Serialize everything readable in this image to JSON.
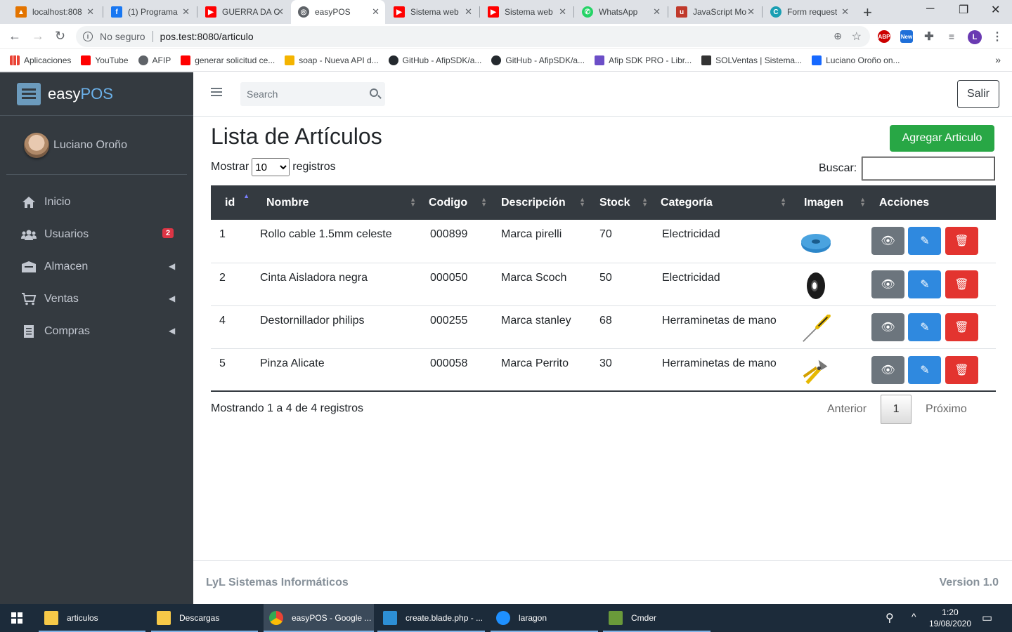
{
  "browser": {
    "tabs": [
      {
        "label": "localhost:808",
        "color": "#e37400"
      },
      {
        "label": "(1) Programa",
        "color": "#1877f2"
      },
      {
        "label": "GUERRA DA C",
        "color": "#ff0000"
      },
      {
        "label": "easyPOS",
        "color": "#5f6368"
      },
      {
        "label": "Sistema web",
        "color": "#ff0000"
      },
      {
        "label": "Sistema web",
        "color": "#ff0000"
      },
      {
        "label": "WhatsApp",
        "color": "#25d366"
      },
      {
        "label": "JavaScript Mo",
        "color": "#c0392b"
      },
      {
        "label": "Form request",
        "color": "#1a9fb3"
      }
    ],
    "address": {
      "security": "No seguro",
      "url": "pos.test:8080/articulo"
    },
    "bookmarks": [
      {
        "label": "Aplicaciones",
        "color": "#4285f4"
      },
      {
        "label": "YouTube",
        "color": "#ff0000"
      },
      {
        "label": "AFIP",
        "color": "#5f6368"
      },
      {
        "label": "generar solicitud ce...",
        "color": "#ff0000"
      },
      {
        "label": "soap - Nueva API d...",
        "color": "#f4b400"
      },
      {
        "label": "GitHub - AfipSDK/a...",
        "color": "#24292e"
      },
      {
        "label": "GitHub - AfipSDK/a...",
        "color": "#24292e"
      },
      {
        "label": "Afip SDK PRO - Libr...",
        "color": "#6c4ec7"
      },
      {
        "label": "SOLVentas | Sistema...",
        "color": "#333333"
      },
      {
        "label": "Luciano Oroño on...",
        "color": "#1769ff"
      }
    ]
  },
  "sidebar": {
    "brand_prefix": "easy",
    "brand_suffix": "POS",
    "user_name": "Luciano Oroño",
    "items": [
      {
        "label": "Inicio",
        "icon": "home-icon",
        "glyph": "⌂"
      },
      {
        "label": "Usuarios",
        "icon": "users-icon",
        "glyph": "👥",
        "badge": "2"
      },
      {
        "label": "Almacen",
        "icon": "warehouse-icon",
        "glyph": "▣",
        "caret": "◀"
      },
      {
        "label": "Ventas",
        "icon": "cart-icon",
        "glyph": "🛒",
        "caret": "◀"
      },
      {
        "label": "Compras",
        "icon": "receipt-icon",
        "glyph": "▤",
        "caret": "◀"
      }
    ]
  },
  "header": {
    "search_placeholder": "Search",
    "logout_label": "Salir"
  },
  "page": {
    "title": "Lista de Artículos",
    "add_label": "Agregar Articulo",
    "show_label": "Mostrar",
    "show_value": "10",
    "records_label": "registros",
    "search_label": "Buscar:"
  },
  "table": {
    "columns": [
      "id",
      "Nombre",
      "Codigo",
      "Descripción",
      "Stock",
      "Categoría",
      "Imagen",
      "Acciones"
    ],
    "rows": [
      {
        "id": "1",
        "nombre": "Rollo cable 1.5mm celeste",
        "codigo": "000899",
        "descripcion": "Marca pirelli",
        "stock": "70",
        "categoria": "Electricidad",
        "image": "blue-cable-roll"
      },
      {
        "id": "2",
        "nombre": "Cinta Aisladora negra",
        "codigo": "000050",
        "descripcion": "Marca Scoch",
        "stock": "50",
        "categoria": "Electricidad",
        "image": "black-tape"
      },
      {
        "id": "4",
        "nombre": "Destornillador philips",
        "codigo": "000255",
        "descripcion": "Marca stanley",
        "stock": "68",
        "categoria": "Herraminetas de mano",
        "image": "screwdriver"
      },
      {
        "id": "5",
        "nombre": "Pinza Alicate",
        "codigo": "000058",
        "descripcion": "Marca Perrito",
        "stock": "30",
        "categoria": "Herraminetas de mano",
        "image": "pliers"
      }
    ],
    "info": "Mostrando 1 a 4 de 4 registros",
    "prev": "Anterior",
    "page": "1",
    "next": "Próximo"
  },
  "footer": {
    "company": "LyL Sistemas Informáticos",
    "version": "Version 1.0"
  },
  "taskbar": {
    "items": [
      {
        "label": "articulos",
        "color": "#f7c948"
      },
      {
        "label": "Descargas",
        "color": "#f7c948"
      },
      {
        "label": "easyPOS - Google ...",
        "color": "#4285f4"
      },
      {
        "label": "create.blade.php - ...",
        "color": "#2d8fd5"
      },
      {
        "label": "laragon",
        "color": "#1e90ff"
      },
      {
        "label": "Cmder",
        "color": "#6a9a3a"
      }
    ],
    "time": "1:20",
    "date": "19/08/2020"
  }
}
